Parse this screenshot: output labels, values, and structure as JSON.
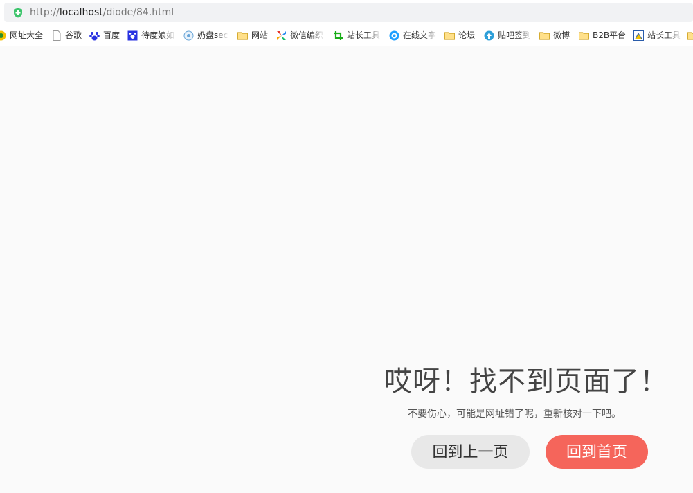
{
  "browser": {
    "url_prefix": "http://",
    "url_host": "localhost",
    "url_path": "/diode/84.html"
  },
  "bookmarks": [
    {
      "label": "网址大全",
      "icon": "globe-icon"
    },
    {
      "label": "谷歌",
      "icon": "page-icon"
    },
    {
      "label": "百度",
      "icon": "baidu-paw-icon"
    },
    {
      "label": "待度娘如",
      "icon": "baidu-paw-icon"
    },
    {
      "label": "奶盘sec",
      "icon": "cloud-icon"
    },
    {
      "label": "网站",
      "icon": "folder-icon"
    },
    {
      "label": "微信编织",
      "icon": "pinwheel-icon"
    },
    {
      "label": "站长工具",
      "icon": "crop-icon"
    },
    {
      "label": "在线文字",
      "icon": "circle-icon"
    },
    {
      "label": "论坛",
      "icon": "folder-icon"
    },
    {
      "label": "贴吧签到",
      "icon": "up-arrow-icon"
    },
    {
      "label": "微博",
      "icon": "folder-icon"
    },
    {
      "label": "B2B平台",
      "icon": "folder-icon"
    },
    {
      "label": "站长工具",
      "icon": "chart-icon"
    }
  ],
  "error": {
    "title": "哎呀！找不到页面了！",
    "subtitle": "不要伤心，可能是网址错了呢，重新核对一下吧。",
    "back_label": "回到上一页",
    "home_label": "回到首页"
  },
  "colors": {
    "home_button": "#f5655b",
    "back_button": "#e8e8e8",
    "background": "#fafafa"
  }
}
